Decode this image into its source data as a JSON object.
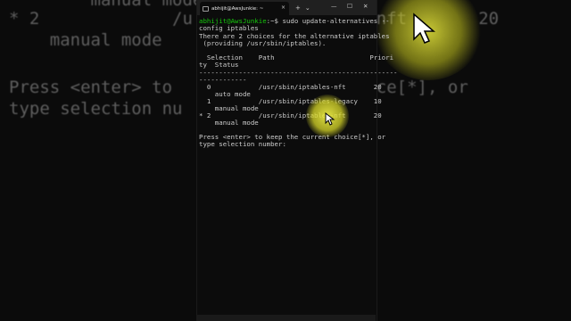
{
  "background_zoom": {
    "lines": [
      "        manual mode",
      "* 2             /u                 -nft       20",
      "    manual mode",
      "",
      "Press <enter> to                choice[*], or",
      "type selection nu"
    ]
  },
  "terminal": {
    "tab_label": "abhijit@AwsJunkie: ~",
    "tab_close": "×",
    "new_tab": "+",
    "dropdown": "⌄",
    "win_minimize": "—",
    "win_maximize": "☐",
    "win_close": "✕",
    "prompt_user": "abhijit@AwsJunkie",
    "prompt_path": ":~$",
    "command": " sudo update-alternatives --",
    "lines": [
      "config iptables",
      "There are 2 choices for the alternative iptables",
      " (providing /usr/sbin/iptables).",
      "",
      "  Selection    Path                        Priori",
      "ty  Status",
      "--------------------------------------------------",
      "------------",
      "  0            /usr/sbin/iptables-nft       20",
      "    auto mode",
      "  1            /usr/sbin/iptables-legacy    10",
      "    manual mode",
      "* 2            /usr/sbin/iptables-nft       20",
      "    manual mode",
      "",
      "Press <enter> to keep the current choice[*], or",
      "type selection number:"
    ]
  },
  "colors": {
    "prompt_user": "#16c60c",
    "prompt_path": "#3b78ff",
    "highlight": "#e8e83c"
  }
}
